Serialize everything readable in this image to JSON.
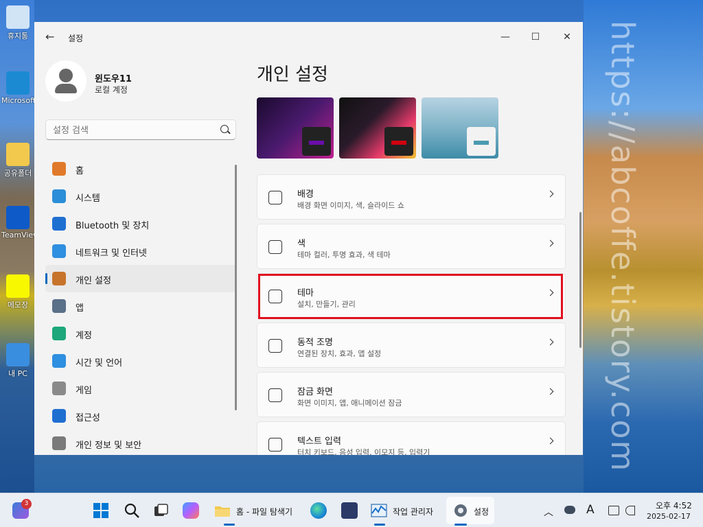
{
  "desktop": {
    "icons": [
      {
        "label": "휴지통",
        "color": "#d0e4f6"
      },
      {
        "label": "Microsoft Edge",
        "color": "#1b8ad3"
      },
      {
        "label": "공유폴더",
        "color": "#f2c94c"
      },
      {
        "label": "TeamViewer",
        "color": "#0e5ac8"
      },
      {
        "label": "메모장",
        "color": "#f8f800"
      },
      {
        "label": "내 PC",
        "color": "#3a8ee0"
      }
    ],
    "watermark": "https://abcoffe.tistory.com"
  },
  "window": {
    "app_title": "설정",
    "controls": {
      "minimize": "—",
      "maximize": "☐",
      "close": "✕"
    },
    "back_glyph": "←"
  },
  "profile": {
    "name": "윈도우11",
    "account_type": "로컬 계정"
  },
  "search": {
    "placeholder": "설정 검색"
  },
  "nav": {
    "items": [
      {
        "label": "홈",
        "icon": "home-icon",
        "color": "#e07a2a"
      },
      {
        "label": "시스템",
        "icon": "system-icon",
        "color": "#2b8ed8"
      },
      {
        "label": "Bluetooth 및 장치",
        "icon": "bluetooth-icon",
        "color": "#1f6fd1"
      },
      {
        "label": "네트워크 및 인터넷",
        "icon": "wifi-icon",
        "color": "#2f8fe0"
      },
      {
        "label": "개인 설정",
        "icon": "brush-icon",
        "color": "#c7742a"
      },
      {
        "label": "앱",
        "icon": "apps-icon",
        "color": "#5a6f88"
      },
      {
        "label": "계정",
        "icon": "account-icon",
        "color": "#1da77a"
      },
      {
        "label": "시간 및 언어",
        "icon": "globe-icon",
        "color": "#2f8fe0"
      },
      {
        "label": "게임",
        "icon": "gamepad-icon",
        "color": "#8a8a8a"
      },
      {
        "label": "접근성",
        "icon": "accessibility-icon",
        "color": "#1f6fd1"
      },
      {
        "label": "개인 정보 및 보안",
        "icon": "shield-icon",
        "color": "#7a7a7a"
      }
    ],
    "selected_index": 4
  },
  "main": {
    "title": "개인 설정",
    "themes": [
      {
        "bg": "linear-gradient(135deg,#1a0a2e,#4a1a6e 50%,#c0208e)",
        "accent": "#6a0ea8",
        "mini": "#222"
      },
      {
        "bg": "linear-gradient(135deg,#111,#2a1a2a 40%,#e43a6a 70%,#f0c030)",
        "accent": "#d00010",
        "mini": "#222"
      },
      {
        "bg": "linear-gradient(180deg,#b6d3e2,#7fb3c8 50%,#3e8ca8)",
        "accent": "#4a9ab0",
        "mini": "#f2f2f2"
      }
    ],
    "cards": [
      {
        "title": "배경",
        "subtitle": "배경 화면 이미지, 색, 슬라이드 쇼",
        "icon": "image-icon"
      },
      {
        "title": "색",
        "subtitle": "테마 컬러, 투명 효과, 색 테마",
        "icon": "palette-icon"
      },
      {
        "title": "테마",
        "subtitle": "설치, 만들기, 관리",
        "icon": "pen-icon"
      },
      {
        "title": "동적 조명",
        "subtitle": "연결된 장치, 효과, 앱 설정",
        "icon": "light-icon"
      },
      {
        "title": "잠금 화면",
        "subtitle": "화면 이미지, 앱, 애니메이션 잠금",
        "icon": "lock-screen-icon"
      },
      {
        "title": "텍스트 입력",
        "subtitle": "터치 키보드, 음성 입력, 이모지 등, 입력기",
        "icon": "keyboard-icon"
      }
    ],
    "highlight_color": "#e01020"
  },
  "taskbar": {
    "widgets_badge": "3",
    "explorer_label": "홈 - 파일 탐색기",
    "taskmgr_label": "작업 관리자",
    "settings_label": "설정",
    "ime_indicator": "A",
    "time": "오후 4:52",
    "date": "2025-02-17",
    "accent": "#0067c0"
  }
}
